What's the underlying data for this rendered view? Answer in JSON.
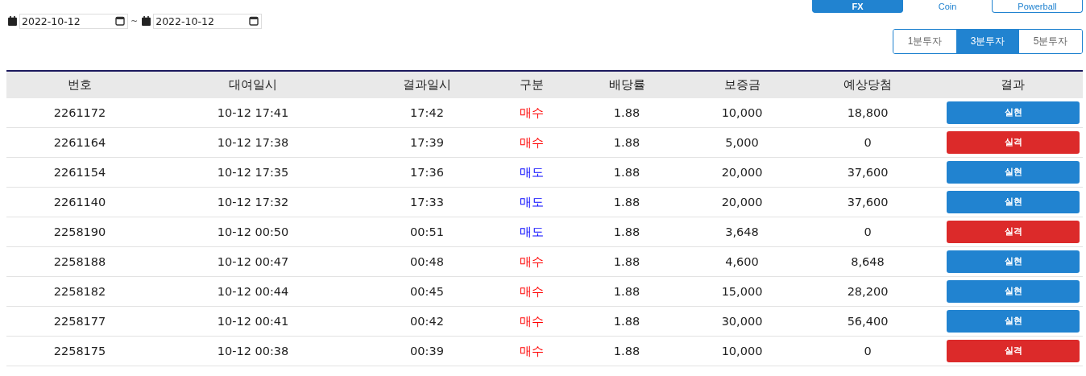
{
  "market_tabs": [
    {
      "label": "FX",
      "selected": true
    },
    {
      "label": "Coin",
      "selected": false
    },
    {
      "label": "Powerball",
      "selected": false
    }
  ],
  "interval_tabs": [
    {
      "label": "1분투자",
      "selected": false
    },
    {
      "label": "3분투자",
      "selected": true
    },
    {
      "label": "5분투자",
      "selected": false
    }
  ],
  "date_range": {
    "from": "2022-10-12",
    "separator": "~",
    "to": "2022-10-12"
  },
  "table": {
    "columns": [
      "번호",
      "대여일시",
      "결과일시",
      "구분",
      "배당률",
      "보증금",
      "예상당첨",
      "결과"
    ],
    "rows": [
      {
        "no": "2261172",
        "rented": "10-12 17:41",
        "result_time": "17:42",
        "side": {
          "text": "매수",
          "kind": "buy"
        },
        "rate": "1.88",
        "deposit": "10,000",
        "expected": "18,800",
        "result": {
          "text": "실현",
          "kind": "win"
        }
      },
      {
        "no": "2261164",
        "rented": "10-12 17:38",
        "result_time": "17:39",
        "side": {
          "text": "매수",
          "kind": "buy"
        },
        "rate": "1.88",
        "deposit": "5,000",
        "expected": "0",
        "result": {
          "text": "실격",
          "kind": "lose"
        }
      },
      {
        "no": "2261154",
        "rented": "10-12 17:35",
        "result_time": "17:36",
        "side": {
          "text": "매도",
          "kind": "sell"
        },
        "rate": "1.88",
        "deposit": "20,000",
        "expected": "37,600",
        "result": {
          "text": "실현",
          "kind": "win"
        }
      },
      {
        "no": "2261140",
        "rented": "10-12 17:32",
        "result_time": "17:33",
        "side": {
          "text": "매도",
          "kind": "sell"
        },
        "rate": "1.88",
        "deposit": "20,000",
        "expected": "37,600",
        "result": {
          "text": "실현",
          "kind": "win"
        }
      },
      {
        "no": "2258190",
        "rented": "10-12 00:50",
        "result_time": "00:51",
        "side": {
          "text": "매도",
          "kind": "sell"
        },
        "rate": "1.88",
        "deposit": "3,648",
        "expected": "0",
        "result": {
          "text": "실격",
          "kind": "lose"
        }
      },
      {
        "no": "2258188",
        "rented": "10-12 00:47",
        "result_time": "00:48",
        "side": {
          "text": "매수",
          "kind": "buy"
        },
        "rate": "1.88",
        "deposit": "4,600",
        "expected": "8,648",
        "result": {
          "text": "실현",
          "kind": "win"
        }
      },
      {
        "no": "2258182",
        "rented": "10-12 00:44",
        "result_time": "00:45",
        "side": {
          "text": "매수",
          "kind": "buy"
        },
        "rate": "1.88",
        "deposit": "15,000",
        "expected": "28,200",
        "result": {
          "text": "실현",
          "kind": "win"
        }
      },
      {
        "no": "2258177",
        "rented": "10-12 00:41",
        "result_time": "00:42",
        "side": {
          "text": "매수",
          "kind": "buy"
        },
        "rate": "1.88",
        "deposit": "30,000",
        "expected": "56,400",
        "result": {
          "text": "실현",
          "kind": "win"
        }
      },
      {
        "no": "2258175",
        "rented": "10-12 00:38",
        "result_time": "00:39",
        "side": {
          "text": "매수",
          "kind": "buy"
        },
        "rate": "1.88",
        "deposit": "10,000",
        "expected": "0",
        "result": {
          "text": "실격",
          "kind": "lose"
        }
      }
    ]
  }
}
